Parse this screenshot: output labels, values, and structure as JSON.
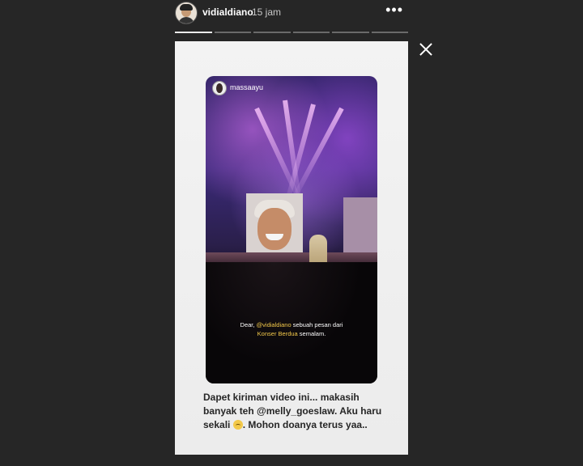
{
  "header": {
    "username": "vidialdiano",
    "time": "15 jam",
    "more_label": "•••"
  },
  "progress": {
    "segments": 6,
    "active_index": 0
  },
  "story": {
    "media": {
      "username": "massaayu",
      "caption_prefix": "Dear, ",
      "caption_mention": "@vidialdiano",
      "caption_mid": " sebuah pesan dari",
      "caption_mention2": "Konser Berdua",
      "caption_suffix": " semalam."
    },
    "text_part1": "Dapet kiriman video ini...  makasih banyak teh ",
    "text_mention": "@melly_goeslaw",
    "text_part2": ". Aku haru sekali ",
    "text_part3": ". Mohon doanya terus yaa..",
    "emoji_icon": "crying-face-icon"
  }
}
